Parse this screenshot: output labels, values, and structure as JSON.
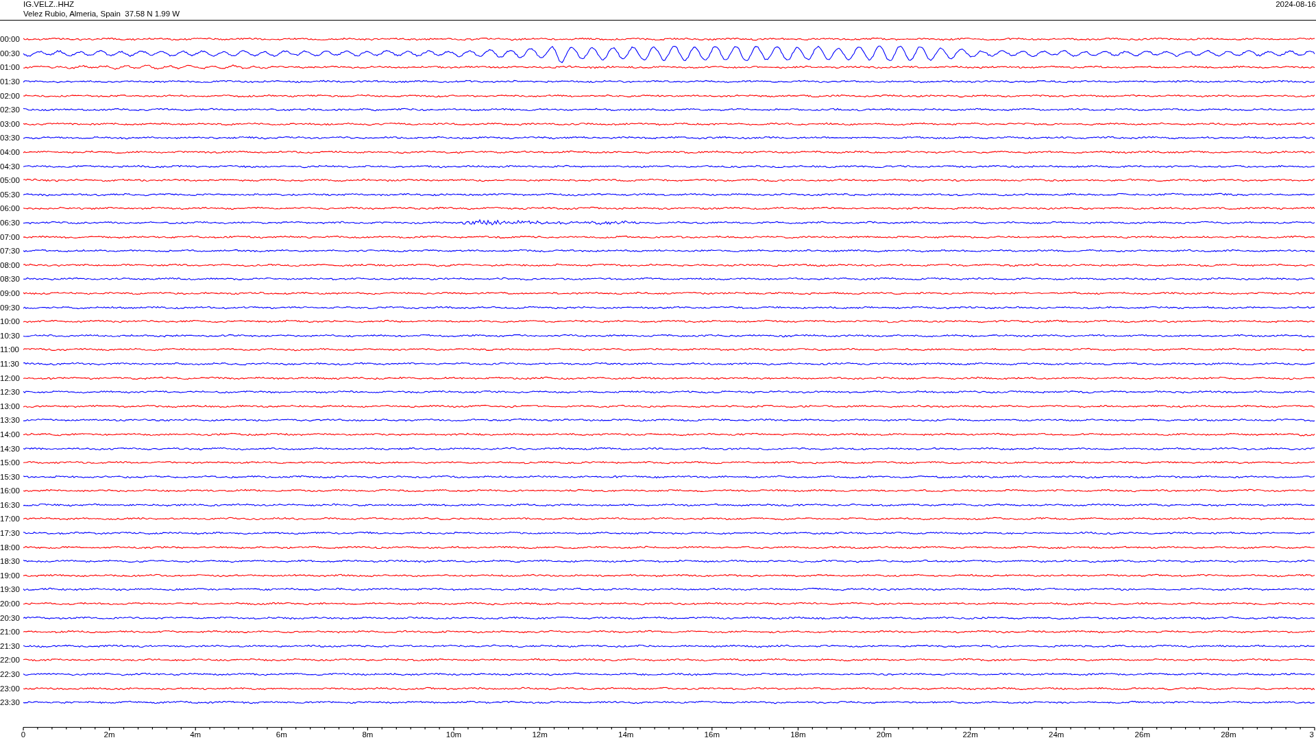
{
  "header": {
    "station": "IG.VELZ..HHZ",
    "location": "Velez Rubio, Almeria, Spain  37.58 N 1.99 W",
    "date": "2024-08-16"
  },
  "traces": [
    {
      "label": "00:00",
      "color": "#ff0000"
    },
    {
      "label": "00:30",
      "color": "#0000ff"
    },
    {
      "label": "01:00",
      "color": "#ff0000"
    },
    {
      "label": "01:30",
      "color": "#0000ff"
    },
    {
      "label": "02:00",
      "color": "#ff0000"
    },
    {
      "label": "02:30",
      "color": "#0000ff"
    },
    {
      "label": "03:00",
      "color": "#ff0000"
    },
    {
      "label": "03:30",
      "color": "#0000ff"
    },
    {
      "label": "04:00",
      "color": "#ff0000"
    },
    {
      "label": "04:30",
      "color": "#0000ff"
    },
    {
      "label": "05:00",
      "color": "#ff0000"
    },
    {
      "label": "05:30",
      "color": "#0000ff"
    },
    {
      "label": "06:00",
      "color": "#ff0000"
    },
    {
      "label": "06:30",
      "color": "#0000ff"
    },
    {
      "label": "07:00",
      "color": "#ff0000"
    },
    {
      "label": "07:30",
      "color": "#0000ff"
    },
    {
      "label": "08:00",
      "color": "#ff0000"
    },
    {
      "label": "08:30",
      "color": "#0000ff"
    },
    {
      "label": "09:00",
      "color": "#ff0000"
    },
    {
      "label": "09:30",
      "color": "#0000ff"
    },
    {
      "label": "10:00",
      "color": "#ff0000"
    },
    {
      "label": "10:30",
      "color": "#0000ff"
    },
    {
      "label": "11:00",
      "color": "#ff0000"
    },
    {
      "label": "11:30",
      "color": "#0000ff"
    },
    {
      "label": "12:00",
      "color": "#ff0000"
    },
    {
      "label": "12:30",
      "color": "#0000ff"
    },
    {
      "label": "13:00",
      "color": "#ff0000"
    },
    {
      "label": "13:30",
      "color": "#0000ff"
    },
    {
      "label": "14:00",
      "color": "#ff0000"
    },
    {
      "label": "14:30",
      "color": "#0000ff"
    },
    {
      "label": "15:00",
      "color": "#ff0000"
    },
    {
      "label": "15:30",
      "color": "#0000ff"
    },
    {
      "label": "16:00",
      "color": "#ff0000"
    },
    {
      "label": "16:30",
      "color": "#0000ff"
    },
    {
      "label": "17:00",
      "color": "#ff0000"
    },
    {
      "label": "17:30",
      "color": "#0000ff"
    },
    {
      "label": "18:00",
      "color": "#ff0000"
    },
    {
      "label": "18:30",
      "color": "#0000ff"
    },
    {
      "label": "19:00",
      "color": "#ff0000"
    },
    {
      "label": "19:30",
      "color": "#0000ff"
    },
    {
      "label": "20:00",
      "color": "#ff0000"
    },
    {
      "label": "20:30",
      "color": "#0000ff"
    },
    {
      "label": "21:00",
      "color": "#ff0000"
    },
    {
      "label": "21:30",
      "color": "#0000ff"
    },
    {
      "label": "22:00",
      "color": "#ff0000"
    },
    {
      "label": "22:30",
      "color": "#0000ff"
    },
    {
      "label": "23:00",
      "color": "#ff0000"
    },
    {
      "label": "23:30",
      "color": "#0000ff"
    }
  ],
  "time_axis": {
    "ticks": [
      "0",
      "2m",
      "4m",
      "6m",
      "8m",
      "10m",
      "12m",
      "14m",
      "16m",
      "18m",
      "20m",
      "22m",
      "24m",
      "26m",
      "28m",
      "3"
    ]
  }
}
